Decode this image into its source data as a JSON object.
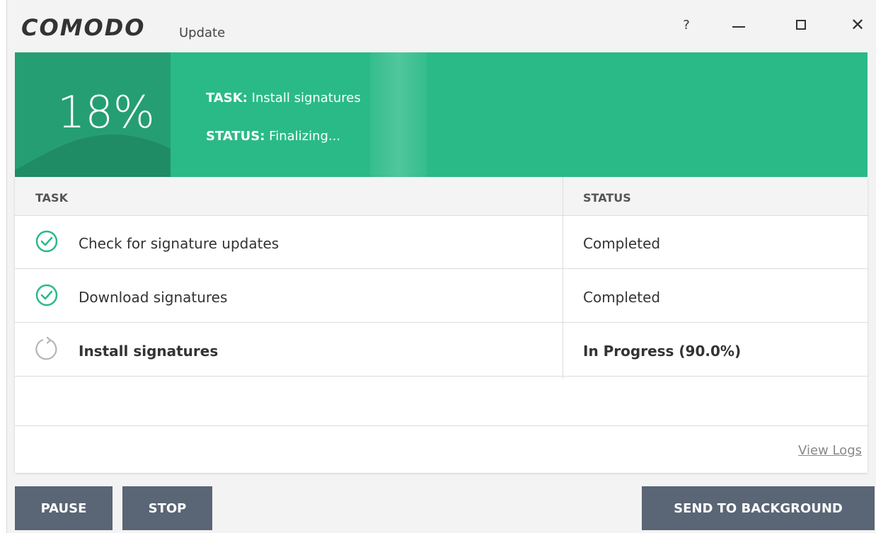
{
  "window": {
    "brand": "COMODO",
    "title": "Update",
    "help_label": "?",
    "close_label": "✕"
  },
  "banner": {
    "percent_text": "18%",
    "progress": 0.18,
    "task_label": "TASK:",
    "task_value": "Install signatures",
    "status_label": "STATUS:",
    "status_value": "Finalizing...",
    "color": "#2aba87"
  },
  "table": {
    "headers": {
      "task": "TASK",
      "status": "STATUS"
    },
    "rows": [
      {
        "icon": "check-circle-icon",
        "task": "Check for signature updates",
        "status": "Completed"
      },
      {
        "icon": "check-circle-icon",
        "task": "Download signatures",
        "status": "Completed"
      },
      {
        "icon": "spinner-icon",
        "task": "Install signatures",
        "status": "In Progress (90.0%)"
      }
    ],
    "view_logs": "View Logs"
  },
  "buttons": {
    "pause": "PAUSE",
    "stop": "STOP",
    "background": "SEND TO BACKGROUND"
  },
  "colors": {
    "accent": "#2aba87",
    "button": "#5a6575",
    "check": "#2aba87"
  }
}
